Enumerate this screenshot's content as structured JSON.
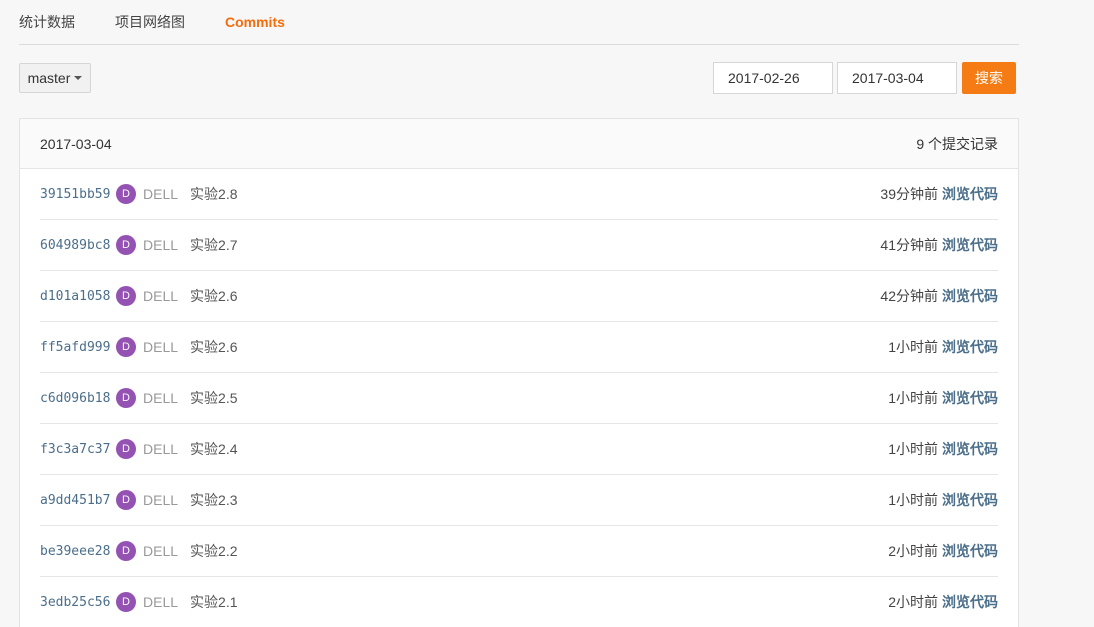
{
  "tabs": [
    {
      "label": "统计数据",
      "active": false
    },
    {
      "label": "项目网络图",
      "active": false
    },
    {
      "label": "Commits",
      "active": true
    }
  ],
  "toolbar": {
    "branch": "master",
    "date_from": "2017-02-26",
    "date_to": "2017-03-04",
    "search_label": "搜索"
  },
  "panel": {
    "date": "2017-03-04",
    "count_label": "9 个提交记录"
  },
  "commits": [
    {
      "sha": "39151bb59",
      "avatar": "D",
      "author": "DELL",
      "message": "实验2.8",
      "time": "39分钟前",
      "browse": "浏览代码"
    },
    {
      "sha": "604989bc8",
      "avatar": "D",
      "author": "DELL",
      "message": "实验2.7",
      "time": "41分钟前",
      "browse": "浏览代码"
    },
    {
      "sha": "d101a1058",
      "avatar": "D",
      "author": "DELL",
      "message": "实验2.6",
      "time": "42分钟前",
      "browse": "浏览代码"
    },
    {
      "sha": "ff5afd999",
      "avatar": "D",
      "author": "DELL",
      "message": "实验2.6",
      "time": "1小时前",
      "browse": "浏览代码"
    },
    {
      "sha": "c6d096b18",
      "avatar": "D",
      "author": "DELL",
      "message": "实验2.5",
      "time": "1小时前",
      "browse": "浏览代码"
    },
    {
      "sha": "f3c3a7c37",
      "avatar": "D",
      "author": "DELL",
      "message": "实验2.4",
      "time": "1小时前",
      "browse": "浏览代码"
    },
    {
      "sha": "a9dd451b7",
      "avatar": "D",
      "author": "DELL",
      "message": "实验2.3",
      "time": "1小时前",
      "browse": "浏览代码"
    },
    {
      "sha": "be39eee28",
      "avatar": "D",
      "author": "DELL",
      "message": "实验2.2",
      "time": "2小时前",
      "browse": "浏览代码"
    },
    {
      "sha": "3edb25c56",
      "avatar": "D",
      "author": "DELL",
      "message": "实验2.1",
      "time": "2小时前",
      "browse": "浏览代码"
    }
  ],
  "colors": {
    "accent": "#f57c14",
    "avatar_bg": "#9452b3",
    "link": "#4b6e8a"
  }
}
